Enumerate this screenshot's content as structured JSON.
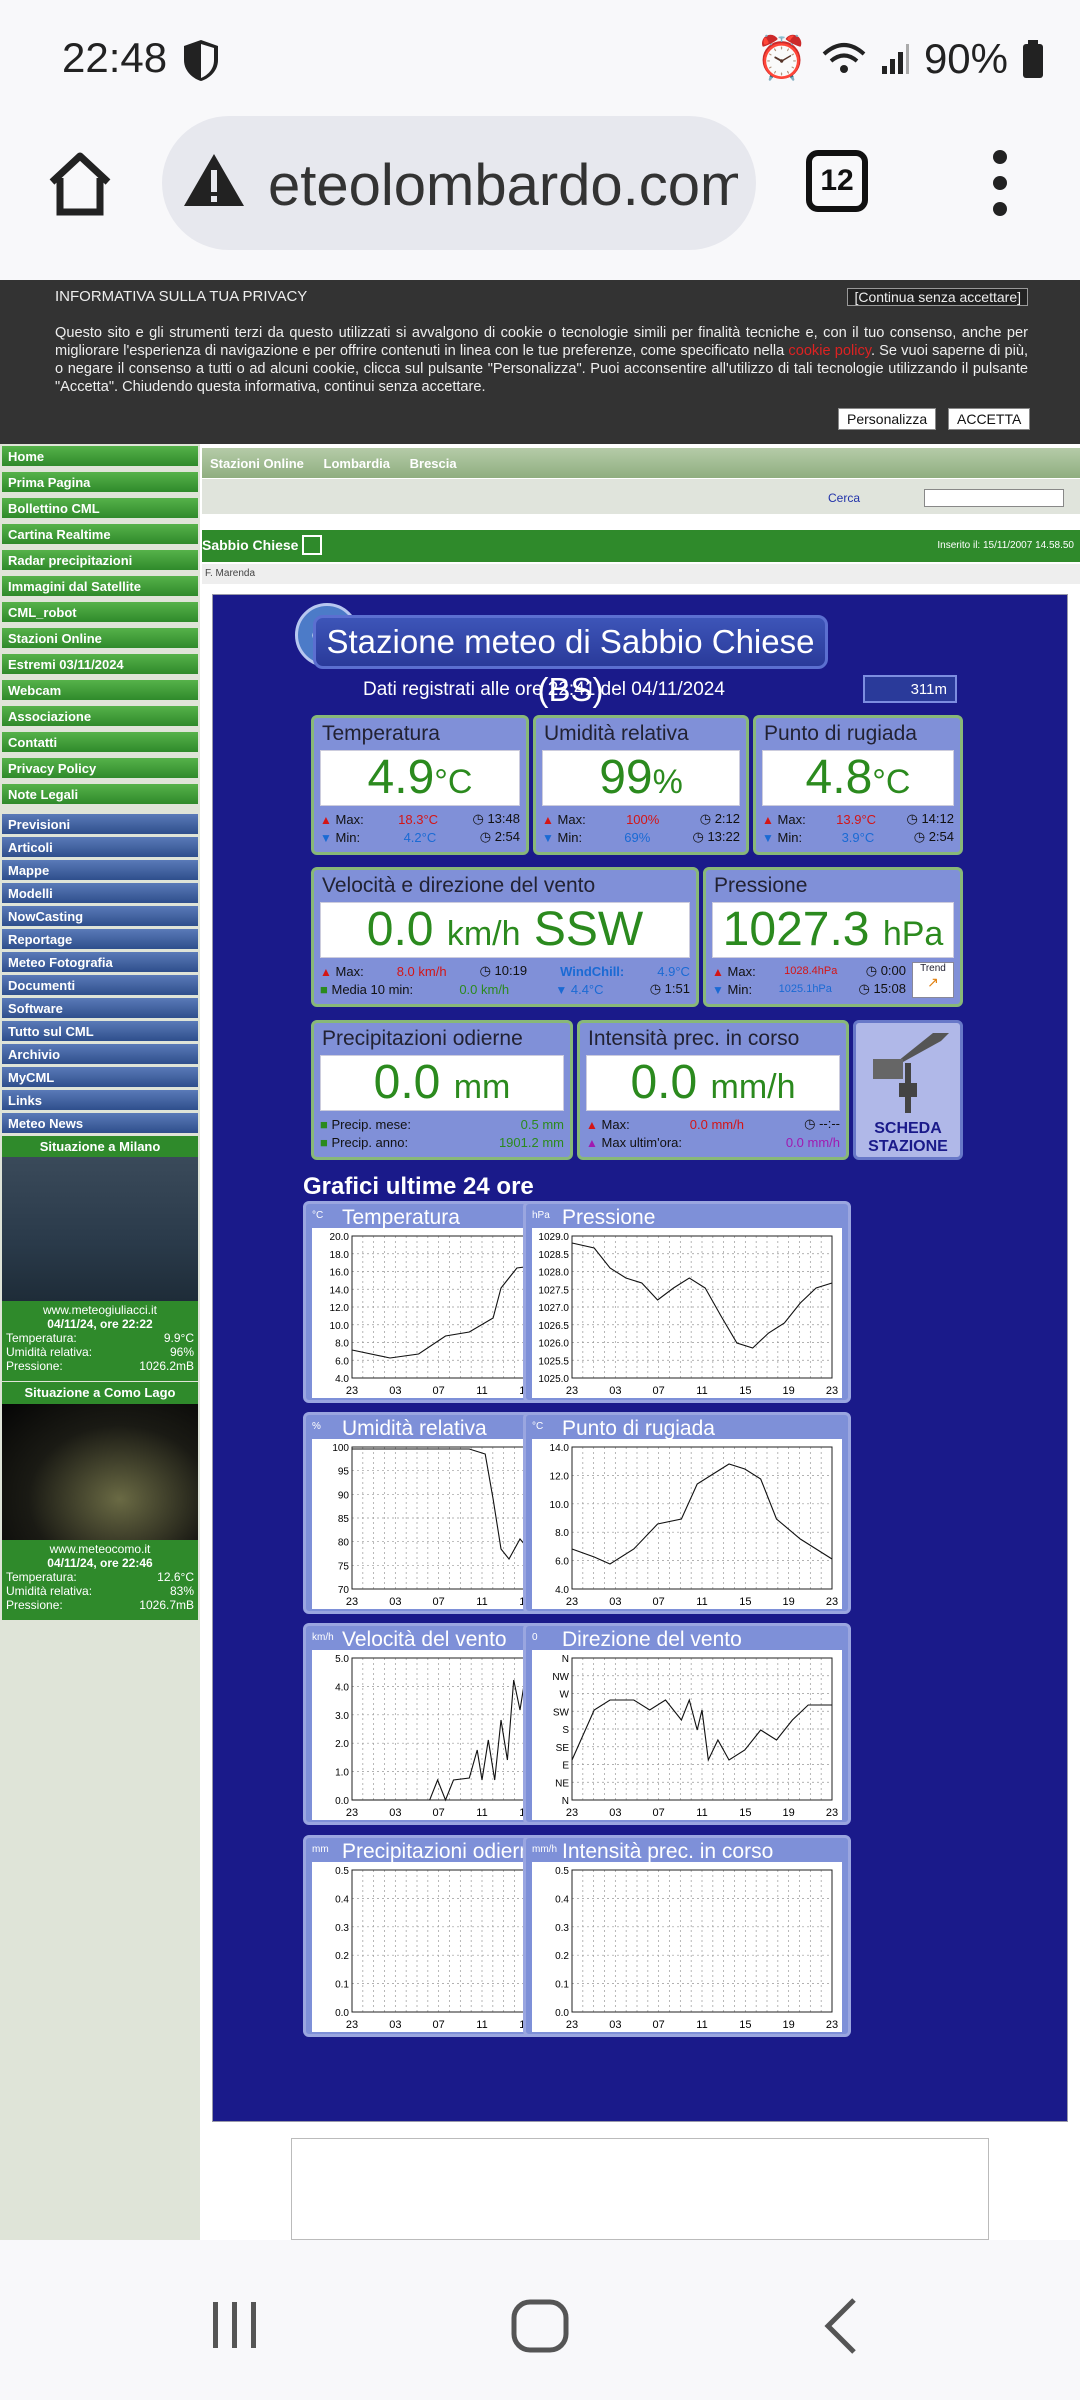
{
  "status": {
    "time": "22:48",
    "battery": "90%"
  },
  "browser": {
    "url": "eteolombardo.com",
    "tabs": "12"
  },
  "privacy": {
    "title": "INFORMATIVA SULLA TUA PRIVACY",
    "continue": "[Continua senza accettare]",
    "text1": "Questo sito e gli strumenti terzi da questo utilizzati si avvalgono di cookie o tecnologie simili per finalità tecniche e, con il tuo consenso, anche per migliorare l'esperienza di navigazione e per offrire contenuti in linea con le tue preferenze, come specificato nella ",
    "link": "cookie policy",
    "text2": ". Se vuoi saperne di più, o negare il consenso a tutti o ad alcuni cookie, clicca sul pulsante \"Personalizza\". Puoi acconsentire all'utilizzo di tali tecnologie utilizzando il pulsante \"Accetta\". Chiudendo questa informativa, continui senza accettare.",
    "customize": "Personalizza",
    "accept": "ACCETTA"
  },
  "sidebar": {
    "green_items": [
      "Home",
      "Prima Pagina",
      "Bollettino CML",
      "Cartina Realtime",
      "Radar precipitazioni",
      "Immagini dal Satellite",
      "CML_robot",
      "Stazioni Online",
      "Estremi 03/11/2024",
      "Webcam",
      "Associazione",
      "Contatti",
      "Privacy Policy",
      "Note Legali"
    ],
    "blue_items": [
      "Previsioni",
      "Articoli",
      "Mappe",
      "Modelli",
      "NowCasting",
      "Reportage",
      "Meteo Fotografia",
      "Documenti",
      "Software",
      "Tutto sul CML",
      "Archivio",
      "MyCML",
      "Links",
      "Meteo News"
    ],
    "milano": {
      "head": "Situazione a Milano",
      "site": "www.meteogiuliacci.it",
      "date": "04/11/24, ore 22:22",
      "temp_l": "Temperatura:",
      "temp": "9.9°C",
      "hum_l": "Umidità relativa:",
      "hum": "96%",
      "pres_l": "Pressione:",
      "pres": "1026.2mB"
    },
    "como": {
      "head": "Situazione a Como Lago",
      "site": "www.meteocomo.it",
      "date": "04/11/24, ore 22:46",
      "temp_l": "Temperatura:",
      "temp": "12.6°C",
      "hum_l": "Umidità relativa:",
      "hum": "83%",
      "pres_l": "Pressione:",
      "pres": "1026.7mB"
    }
  },
  "topnav": {
    "a": "Stazioni Online",
    "b": "Lombardia",
    "c": "Brescia",
    "search": "Cerca"
  },
  "page": {
    "title": "Sabbio Chiese",
    "inserted": "Inserito il: 15/11/2007 14.58.50",
    "author": "F. Marenda"
  },
  "station": {
    "logo": "CML",
    "title": "Stazione meteo di Sabbio Chiese (BS)",
    "subtitle": "Dati registrati alle ore 22:41 del 04/11/2024",
    "altitude": "311m",
    "temp": {
      "label": "Temperatura",
      "value": "4.9",
      "unit": "°C",
      "max": "18.3°C",
      "max_t": "13:48",
      "min": "4.2°C",
      "min_t": "2:54"
    },
    "hum": {
      "label": "Umidità relativa",
      "value": "99",
      "unit": "%",
      "max": "100%",
      "max_t": "2:12",
      "min": "69%",
      "min_t": "13:22"
    },
    "dew": {
      "label": "Punto di rugiada",
      "value": "4.8",
      "unit": "°C",
      "max": "13.9°C",
      "max_t": "14:12",
      "min": "3.9°C",
      "min_t": "2:54"
    },
    "wind": {
      "label": "Velocità e direzione del vento",
      "value": "0.0",
      "unit": "km/h",
      "dir": "SSW",
      "max": "8.0 km/h",
      "max_t": "10:19",
      "avg_l": "Media 10 min:",
      "avg": "0.0 km/h",
      "chill_l": "WindChill:",
      "chill": "4.9°C",
      "chill_min": "4.4°C",
      "chill_t": "1:51"
    },
    "pres": {
      "label": "Pressione",
      "value": "1027.3",
      "unit": "hPa",
      "max": "1028.4hPa",
      "max_t": "0:00",
      "min": "1025.1hPa",
      "min_t": "15:08",
      "trend": "Trend"
    },
    "rain": {
      "label": "Precipitazioni odierne",
      "value": "0.0",
      "unit": "mm",
      "month_l": "Precip. mese:",
      "month": "0.5 mm",
      "year_l": "Precip. anno:",
      "year": "1901.2 mm"
    },
    "rate": {
      "label": "Intensità prec. in corso",
      "value": "0.0",
      "unit": "mm/h",
      "max": "0.0 mm/h",
      "max_t": "--:--",
      "maxh_l": "Max ultim'ora:",
      "maxh": "0.0 mm/h"
    },
    "scheda": "SCHEDA STAZIONE",
    "labels": {
      "max": "Max:",
      "min": "Min:"
    },
    "graphs_title": "Grafici ultime 24 ore"
  },
  "graphs": [
    {
      "title": "Temperatura",
      "unit": "°C",
      "yt": [
        "20.0",
        "18.0",
        "16.0",
        "14.0",
        "12.0",
        "10.0",
        "8.0",
        "6.0",
        "4.0"
      ]
    },
    {
      "title": "Pressione",
      "unit": "hPa",
      "yt": [
        "1029.0",
        "1028.5",
        "1028.0",
        "1027.5",
        "1027.0",
        "1026.5",
        "1026.0",
        "1025.5",
        "1025.0"
      ]
    },
    {
      "title": "Umidità relativa",
      "unit": "%",
      "yt": [
        "100",
        "95",
        "90",
        "85",
        "80",
        "75",
        "70"
      ]
    },
    {
      "title": "Punto di rugiada",
      "unit": "°C",
      "yt": [
        "14.0",
        "12.0",
        "10.0",
        "8.0",
        "6.0",
        "4.0"
      ]
    },
    {
      "title": "Velocità del vento",
      "unit": "km/h",
      "yt": [
        "5.0",
        "4.0",
        "3.0",
        "2.0",
        "1.0",
        "0.0"
      ]
    },
    {
      "title": "Direzione del vento",
      "unit": "0",
      "yt": [
        "N",
        "NW",
        "W",
        "SW",
        "S",
        "SE",
        "E",
        "NE",
        "N"
      ]
    },
    {
      "title": "Precipitazioni odierne",
      "unit": "mm",
      "yt": [
        "0.5",
        "0.4",
        "0.3",
        "0.2",
        "0.1",
        "0.0"
      ]
    },
    {
      "title": "Intensità prec. in corso",
      "unit": "mm/h",
      "yt": [
        "0.5",
        "0.4",
        "0.3",
        "0.2",
        "0.1",
        "0.0"
      ]
    }
  ],
  "xticks": [
    "23",
    "03",
    "07",
    "11",
    "15",
    "19",
    "23"
  ]
}
